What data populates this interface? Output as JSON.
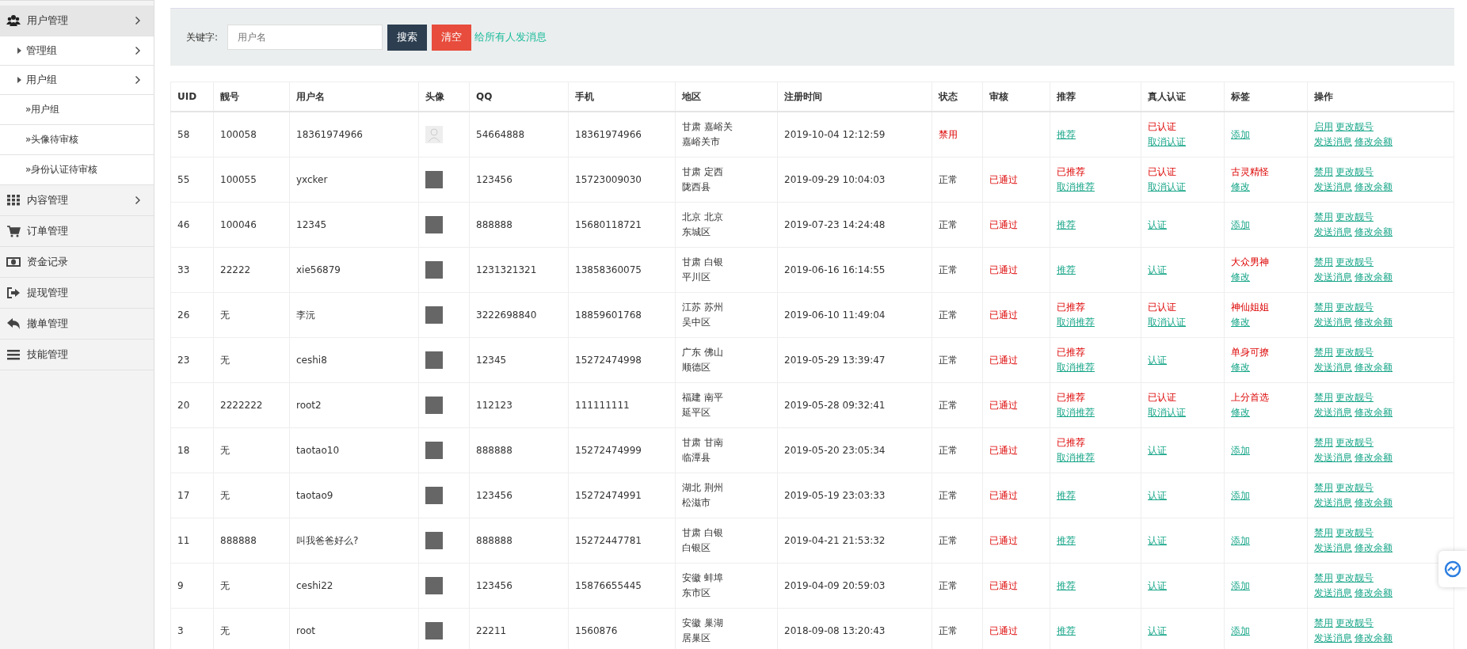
{
  "sidebar": {
    "items": [
      {
        "label": "用户管理",
        "has_submenu": true,
        "expanded": true,
        "children": [
          {
            "label": "管理组",
            "has_submenu": true
          },
          {
            "label": "用户组",
            "has_submenu": true,
            "expanded": true,
            "children": [
              {
                "label": "»用户组"
              },
              {
                "label": "»头像待审核"
              },
              {
                "label": "»身份认证待审核"
              }
            ]
          }
        ]
      },
      {
        "label": "内容管理",
        "has_submenu": true
      },
      {
        "label": "订单管理",
        "has_submenu": false
      },
      {
        "label": "资金记录",
        "has_submenu": false
      },
      {
        "label": "提现管理",
        "has_submenu": false
      },
      {
        "label": "撤单管理",
        "has_submenu": false
      },
      {
        "label": "技能管理",
        "has_submenu": false
      }
    ]
  },
  "filter": {
    "label": "关键字:",
    "search": {
      "placeholder": "用户名"
    },
    "buttons": [
      {
        "label": "搜索",
        "kind": "primary"
      },
      {
        "label": "清空",
        "kind": "danger"
      }
    ],
    "link": "给所有人发消息"
  },
  "table": {
    "columns": [
      "UID",
      "靓号",
      "用户名",
      "头像",
      "QQ",
      "手机",
      "地区",
      "注册时间",
      "状态",
      "审核",
      "推荐",
      "真人认证",
      "标签",
      "操作"
    ],
    "rows": [
      {
        "uid": "58",
        "number": "100058",
        "username": "18361974966",
        "avatar": {
          "kind": "default"
        },
        "qq": "54664888",
        "phone": "18361974966",
        "region": [
          "甘肃 嘉峪关",
          "嘉峪关市"
        ],
        "registered": "2019-10-04 12:12:59",
        "status": {
          "text": "禁用",
          "alert": true
        },
        "review": "",
        "recommend": [
          {
            "kind": "link",
            "text": "推荐"
          }
        ],
        "verify": [
          {
            "kind": "note",
            "text": "已认证"
          },
          {
            "kind": "link",
            "text": "取消认证"
          }
        ],
        "tag": [
          {
            "kind": "link",
            "text": "添加"
          }
        ],
        "actions": [
          "启用",
          "更改靓号",
          "发送消息",
          "修改余额"
        ]
      },
      {
        "uid": "55",
        "number": "100055",
        "username": "yxcker",
        "avatar": {
          "kind": "photo"
        },
        "qq": "123456",
        "phone": "15723009030",
        "region": [
          "甘肃 定西",
          "陇西县"
        ],
        "registered": "2019-09-29 10:04:03",
        "status": {
          "text": "正常",
          "alert": false
        },
        "review": "已通过",
        "recommend": [
          {
            "kind": "note",
            "text": "已推荐"
          },
          {
            "kind": "link",
            "text": "取消推荐"
          }
        ],
        "verify": [
          {
            "kind": "note",
            "text": "已认证"
          },
          {
            "kind": "link",
            "text": "取消认证"
          }
        ],
        "tag": [
          {
            "kind": "note",
            "text": "古灵精怪"
          },
          {
            "kind": "link",
            "text": "修改"
          }
        ],
        "actions": [
          "禁用",
          "更改靓号",
          "发送消息",
          "修改余额"
        ]
      },
      {
        "uid": "46",
        "number": "100046",
        "username": "12345",
        "avatar": {
          "kind": "photo"
        },
        "qq": "888888",
        "phone": "15680118721",
        "region": [
          "北京 北京",
          "东城区"
        ],
        "registered": "2019-07-23 14:24:48",
        "status": {
          "text": "正常",
          "alert": false
        },
        "review": "已通过",
        "recommend": [
          {
            "kind": "link",
            "text": "推荐"
          }
        ],
        "verify": [
          {
            "kind": "link",
            "text": "认证"
          }
        ],
        "tag": [
          {
            "kind": "link",
            "text": "添加"
          }
        ],
        "actions": [
          "禁用",
          "更改靓号",
          "发送消息",
          "修改余额"
        ]
      },
      {
        "uid": "33",
        "number": "22222",
        "username": "xie56879",
        "avatar": {
          "kind": "photo"
        },
        "qq": "1231321321",
        "phone": "13858360075",
        "region": [
          "甘肃 白银",
          "平川区"
        ],
        "registered": "2019-06-16 16:14:55",
        "status": {
          "text": "正常",
          "alert": false
        },
        "review": "已通过",
        "recommend": [
          {
            "kind": "link",
            "text": "推荐"
          }
        ],
        "verify": [
          {
            "kind": "link",
            "text": "认证"
          }
        ],
        "tag": [
          {
            "kind": "note",
            "text": "大众男神"
          },
          {
            "kind": "link",
            "text": "修改"
          }
        ],
        "actions": [
          "禁用",
          "更改靓号",
          "发送消息",
          "修改余额"
        ]
      },
      {
        "uid": "26",
        "number": "无",
        "username": "李沅",
        "avatar": {
          "kind": "photo"
        },
        "qq": "3222698840",
        "phone": "18859601768",
        "region": [
          "江苏 苏州",
          "吴中区"
        ],
        "registered": "2019-06-10 11:49:04",
        "status": {
          "text": "正常",
          "alert": false
        },
        "review": "已通过",
        "recommend": [
          {
            "kind": "note",
            "text": "已推荐"
          },
          {
            "kind": "link",
            "text": "取消推荐"
          }
        ],
        "verify": [
          {
            "kind": "note",
            "text": "已认证"
          },
          {
            "kind": "link",
            "text": "取消认证"
          }
        ],
        "tag": [
          {
            "kind": "note",
            "text": "神仙姐姐"
          },
          {
            "kind": "link",
            "text": "修改"
          }
        ],
        "actions": [
          "禁用",
          "更改靓号",
          "发送消息",
          "修改余额"
        ]
      },
      {
        "uid": "23",
        "number": "无",
        "username": "ceshi8",
        "avatar": {
          "kind": "photo"
        },
        "qq": "12345",
        "phone": "15272474998",
        "region": [
          "广东 佛山",
          "顺德区"
        ],
        "registered": "2019-05-29 13:39:47",
        "status": {
          "text": "正常",
          "alert": false
        },
        "review": "已通过",
        "recommend": [
          {
            "kind": "note",
            "text": "已推荐"
          },
          {
            "kind": "link",
            "text": "取消推荐"
          }
        ],
        "verify": [
          {
            "kind": "link",
            "text": "认证"
          }
        ],
        "tag": [
          {
            "kind": "note",
            "text": "单身可撩"
          },
          {
            "kind": "link",
            "text": "修改"
          }
        ],
        "actions": [
          "禁用",
          "更改靓号",
          "发送消息",
          "修改余额"
        ]
      },
      {
        "uid": "20",
        "number": "2222222",
        "username": "root2",
        "avatar": {
          "kind": "photo"
        },
        "qq": "112123",
        "phone": "111111111",
        "region": [
          "福建 南平",
          "延平区"
        ],
        "registered": "2019-05-28 09:32:41",
        "status": {
          "text": "正常",
          "alert": false
        },
        "review": "已通过",
        "recommend": [
          {
            "kind": "note",
            "text": "已推荐"
          },
          {
            "kind": "link",
            "text": "取消推荐"
          }
        ],
        "verify": [
          {
            "kind": "note",
            "text": "已认证"
          },
          {
            "kind": "link",
            "text": "取消认证"
          }
        ],
        "tag": [
          {
            "kind": "note",
            "text": "上分首选"
          },
          {
            "kind": "link",
            "text": "修改"
          }
        ],
        "actions": [
          "禁用",
          "更改靓号",
          "发送消息",
          "修改余额"
        ]
      },
      {
        "uid": "18",
        "number": "无",
        "username": "taotao10",
        "avatar": {
          "kind": "photo"
        },
        "qq": "888888",
        "phone": "15272474999",
        "region": [
          "甘肃 甘南",
          "临潭县"
        ],
        "registered": "2019-05-20 23:05:34",
        "status": {
          "text": "正常",
          "alert": false
        },
        "review": "已通过",
        "recommend": [
          {
            "kind": "note",
            "text": "已推荐"
          },
          {
            "kind": "link",
            "text": "取消推荐"
          }
        ],
        "verify": [
          {
            "kind": "link",
            "text": "认证"
          }
        ],
        "tag": [
          {
            "kind": "link",
            "text": "添加"
          }
        ],
        "actions": [
          "禁用",
          "更改靓号",
          "发送消息",
          "修改余额"
        ]
      },
      {
        "uid": "17",
        "number": "无",
        "username": "taotao9",
        "avatar": {
          "kind": "photo"
        },
        "qq": "123456",
        "phone": "15272474991",
        "region": [
          "湖北 荆州",
          "松滋市"
        ],
        "registered": "2019-05-19 23:03:33",
        "status": {
          "text": "正常",
          "alert": false
        },
        "review": "已通过",
        "recommend": [
          {
            "kind": "link",
            "text": "推荐"
          }
        ],
        "verify": [
          {
            "kind": "link",
            "text": "认证"
          }
        ],
        "tag": [
          {
            "kind": "link",
            "text": "添加"
          }
        ],
        "actions": [
          "禁用",
          "更改靓号",
          "发送消息",
          "修改余额"
        ]
      },
      {
        "uid": "11",
        "number": "888888",
        "username": "叫我爸爸好么?",
        "avatar": {
          "kind": "photo"
        },
        "qq": "888888",
        "phone": "15272447781",
        "region": [
          "甘肃 白银",
          "白银区"
        ],
        "registered": "2019-04-21 21:53:32",
        "status": {
          "text": "正常",
          "alert": false
        },
        "review": "已通过",
        "recommend": [
          {
            "kind": "link",
            "text": "推荐"
          }
        ],
        "verify": [
          {
            "kind": "link",
            "text": "认证"
          }
        ],
        "tag": [
          {
            "kind": "link",
            "text": "添加"
          }
        ],
        "actions": [
          "禁用",
          "更改靓号",
          "发送消息",
          "修改余额"
        ]
      },
      {
        "uid": "9",
        "number": "无",
        "username": "ceshi22",
        "avatar": {
          "kind": "photo"
        },
        "qq": "123456",
        "phone": "15876655445",
        "region": [
          "安徽 蚌埠",
          "东市区"
        ],
        "registered": "2019-04-09 20:59:03",
        "status": {
          "text": "正常",
          "alert": false
        },
        "review": "已通过",
        "recommend": [
          {
            "kind": "link",
            "text": "推荐"
          }
        ],
        "verify": [
          {
            "kind": "link",
            "text": "认证"
          }
        ],
        "tag": [
          {
            "kind": "link",
            "text": "添加"
          }
        ],
        "actions": [
          "禁用",
          "更改靓号",
          "发送消息",
          "修改余额"
        ]
      },
      {
        "uid": "3",
        "number": "无",
        "username": "root",
        "avatar": {
          "kind": "photo"
        },
        "qq": "22211",
        "phone": "1560876",
        "region": [
          "安徽 巢湖",
          "居巢区"
        ],
        "registered": "2018-09-08 13:20:43",
        "status": {
          "text": "正常",
          "alert": false
        },
        "review": "已通过",
        "recommend": [
          {
            "kind": "link",
            "text": "推荐"
          }
        ],
        "verify": [
          {
            "kind": "link",
            "text": "认证"
          }
        ],
        "tag": [
          {
            "kind": "link",
            "text": "添加"
          }
        ],
        "actions": [
          "禁用",
          "更改靓号",
          "发送消息",
          "修改余额"
        ]
      }
    ]
  }
}
